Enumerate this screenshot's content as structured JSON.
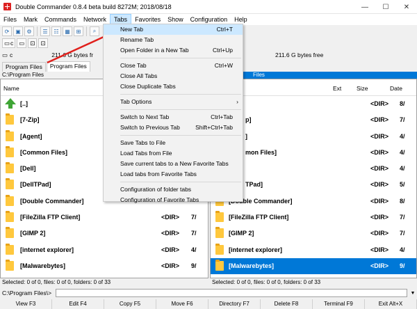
{
  "window": {
    "title": "Double Commander 0.8.4 beta build 8272M; 2018/08/18",
    "minimize": "—",
    "maximize": "☐",
    "close": "✕"
  },
  "menu": [
    "Files",
    "Mark",
    "Commands",
    "Network",
    "Tabs",
    "Favorites",
    "Show",
    "Configuration",
    "Help"
  ],
  "left": {
    "drive_letter": "c",
    "drive_free": "211.6 G bytes fr",
    "tabs": [
      "Program Files",
      "Program Files"
    ],
    "path": "C:\\Program Files",
    "columns": {
      "name": "Name"
    },
    "rows": [
      {
        "name": "[..]",
        "size": "",
        "date": "",
        "up": true
      },
      {
        "name": "[7-Zip]",
        "size": "",
        "date": ""
      },
      {
        "name": "[Agent]",
        "size": "",
        "date": ""
      },
      {
        "name": "[Common Files]",
        "size": "",
        "date": ""
      },
      {
        "name": "[Dell]",
        "size": "",
        "date": ""
      },
      {
        "name": "[DellTPad]",
        "size": "",
        "date": ""
      },
      {
        "name": "[Double Commander]",
        "size": "",
        "date": ""
      },
      {
        "name": "[FileZilla FTP Client]",
        "size": "<DIR>",
        "date": "7/"
      },
      {
        "name": "[GIMP 2]",
        "size": "<DIR>",
        "date": "7/"
      },
      {
        "name": "[internet explorer]",
        "size": "<DIR>",
        "date": "4/"
      },
      {
        "name": "[Malwarebytes]",
        "size": "<DIR>",
        "date": "9/"
      }
    ],
    "status": "Selected: 0 of 0, files: 0 of 0, folders: 0 of 33"
  },
  "right": {
    "drive_free": "211.6 G bytes free",
    "tab_label": "...",
    "path": "Files",
    "columns": {
      "ext": "Ext",
      "size": "Size",
      "date": "Date"
    },
    "rows": [
      {
        "name": "",
        "size": "<DIR>",
        "date": "8/",
        "up": true
      },
      {
        "name": "p]",
        "size": "<DIR>",
        "date": "7/"
      },
      {
        "name": "]",
        "size": "<DIR>",
        "date": "4/"
      },
      {
        "name": "mon Files]",
        "size": "<DIR>",
        "date": "4/"
      },
      {
        "name": "",
        "size": "<DIR>",
        "date": "4/"
      },
      {
        "name": "TPad]",
        "size": "<DIR>",
        "date": "5/"
      },
      {
        "name": "[Double Commander]",
        "size": "<DIR>",
        "date": "8/"
      },
      {
        "name": "[FileZilla FTP Client]",
        "size": "<DIR>",
        "date": "7/"
      },
      {
        "name": "[GIMP 2]",
        "size": "<DIR>",
        "date": "7/"
      },
      {
        "name": "[internet explorer]",
        "size": "<DIR>",
        "date": "4/"
      },
      {
        "name": "[Malwarebytes]",
        "size": "<DIR>",
        "date": "9/",
        "selected": true
      }
    ],
    "status": "Selected: 0 of 0, files: 0 of 0, folders: 0 of 33"
  },
  "cmdline": {
    "label": "C:\\Program Files\\>",
    "drop": "▼"
  },
  "fkeys": [
    "View F3",
    "Edit F4",
    "Copy F5",
    "Move F6",
    "Directory F7",
    "Delete F8",
    "Terminal F9",
    "Exit Alt+X"
  ],
  "tabs_menu": [
    {
      "label": "New Tab",
      "shortcut": "Ctrl+T",
      "hover": true
    },
    {
      "label": "Rename Tab",
      "shortcut": ""
    },
    {
      "label": "Open Folder in a New Tab",
      "shortcut": "Ctrl+Up"
    },
    {
      "sep": true
    },
    {
      "label": "Close Tab",
      "shortcut": "Ctrl+W"
    },
    {
      "label": "Close All Tabs",
      "shortcut": ""
    },
    {
      "label": "Close Duplicate Tabs",
      "shortcut": ""
    },
    {
      "sep": true
    },
    {
      "label": "Tab Options",
      "shortcut": "",
      "submenu": true
    },
    {
      "sep": true
    },
    {
      "label": "Switch to Next Tab",
      "shortcut": "Ctrl+Tab"
    },
    {
      "label": "Switch to Previous Tab",
      "shortcut": "Shift+Ctrl+Tab"
    },
    {
      "sep": true
    },
    {
      "label": "Save Tabs to File",
      "shortcut": ""
    },
    {
      "label": "Load Tabs from File",
      "shortcut": ""
    },
    {
      "label": "Save current tabs to a New Favorite Tabs",
      "shortcut": ""
    },
    {
      "label": "Load tabs from Favorite Tabs",
      "shortcut": ""
    },
    {
      "sep": true
    },
    {
      "label": "Configuration of folder tabs",
      "shortcut": ""
    },
    {
      "label": "Configuration of Favorite Tabs",
      "shortcut": ""
    }
  ],
  "colors": {
    "selection": "#0078d7",
    "folder": "#ffc83d",
    "menu_hover": "#cce8ff",
    "arrow": "#e0201c"
  }
}
